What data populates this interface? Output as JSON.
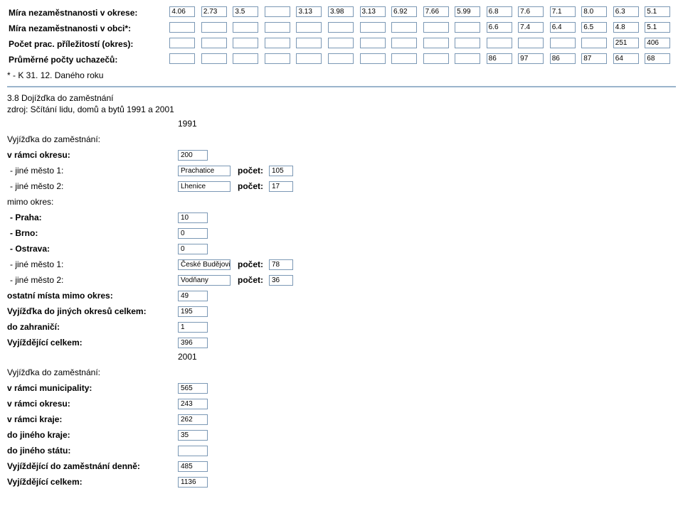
{
  "top": {
    "rows": [
      {
        "label": "Míra nezaměstnanosti v okrese:",
        "vals": [
          "4.06",
          "2.73",
          "3.5",
          "",
          "3.13",
          "3.98",
          "3.13",
          "6.92",
          "7.66",
          "5.99",
          "6.8",
          "7.6",
          "7.1",
          "8.0",
          "6.3",
          "5.1"
        ]
      },
      {
        "label": "Míra nezaměstnanosti v obci*:",
        "vals": [
          "",
          "",
          "",
          "",
          "",
          "",
          "",
          "",
          "",
          "",
          "6.6",
          "7.4",
          "6.4",
          "6.5",
          "4.8",
          "5.1"
        ]
      },
      {
        "label": "Počet prac. příležitostí (okres):",
        "vals": [
          "",
          "",
          "",
          "",
          "",
          "",
          "",
          "",
          "",
          "",
          "",
          "",
          "",
          "",
          "251",
          "406"
        ]
      },
      {
        "label": "Průměrné počty uchazečů:",
        "vals": [
          "",
          "",
          "",
          "",
          "",
          "",
          "",
          "",
          "",
          "",
          "86",
          "97",
          "86",
          "87",
          "64",
          "68"
        ]
      }
    ],
    "note": "* - K 31. 12. Daného roku"
  },
  "section38": {
    "title": "3.8 Dojížďka do zaměstnání",
    "source": "zdroj: Sčítání lidu, domů a bytů 1991 a 2001",
    "year1991": "1991",
    "year2001": "2001",
    "pocet": "počet:",
    "sub1": "Vyjížďka do zaměstnání:",
    "rows1991": [
      {
        "label": "v rámci okresu:",
        "bold": true,
        "val": "200"
      },
      {
        "label": "- jiné město 1:",
        "type": "city",
        "city": "Prachatice",
        "count": "105"
      },
      {
        "label": "- jiné město 2:",
        "type": "city",
        "city": "Lhenice",
        "count": "17"
      },
      {
        "label": "mimo okres:",
        "type": "text",
        "thin": true
      },
      {
        "label": "- Praha:",
        "bold": true,
        "val": "10"
      },
      {
        "label": "- Brno:",
        "bold": true,
        "val": "0"
      },
      {
        "label": "- Ostrava:",
        "bold": true,
        "val": "0"
      },
      {
        "label": "- jiné město 1:",
        "type": "city",
        "city": "České Budějovi",
        "count": "78"
      },
      {
        "label": "- jiné město 2:",
        "type": "city",
        "city": "Vodňany",
        "count": "36"
      },
      {
        "label": "ostatní místa mimo okres:",
        "bold": true,
        "val": "49"
      },
      {
        "label": "Vyjížďka do jiných okresů celkem:",
        "bold": true,
        "val": "195"
      },
      {
        "label": "do zahraničí:",
        "bold": true,
        "val": "1"
      },
      {
        "label": "Vyjíždějící celkem:",
        "bold": true,
        "val": "396"
      }
    ],
    "rows2001": [
      {
        "label": "v rámci municipality:",
        "bold": true,
        "val": "565"
      },
      {
        "label": "v rámci okresu:",
        "bold": true,
        "val": "243"
      },
      {
        "label": "v rámci kraje:",
        "bold": true,
        "val": "262"
      },
      {
        "label": "do jiného kraje:",
        "bold": true,
        "val": "35"
      },
      {
        "label": "do jiného státu:",
        "bold": true,
        "val": ""
      },
      {
        "label": "Vyjíždějící do zaměstnání denně:",
        "bold": true,
        "val": "485"
      },
      {
        "label": "Vyjíždějící celkem:",
        "bold": true,
        "val": "1136"
      }
    ]
  }
}
